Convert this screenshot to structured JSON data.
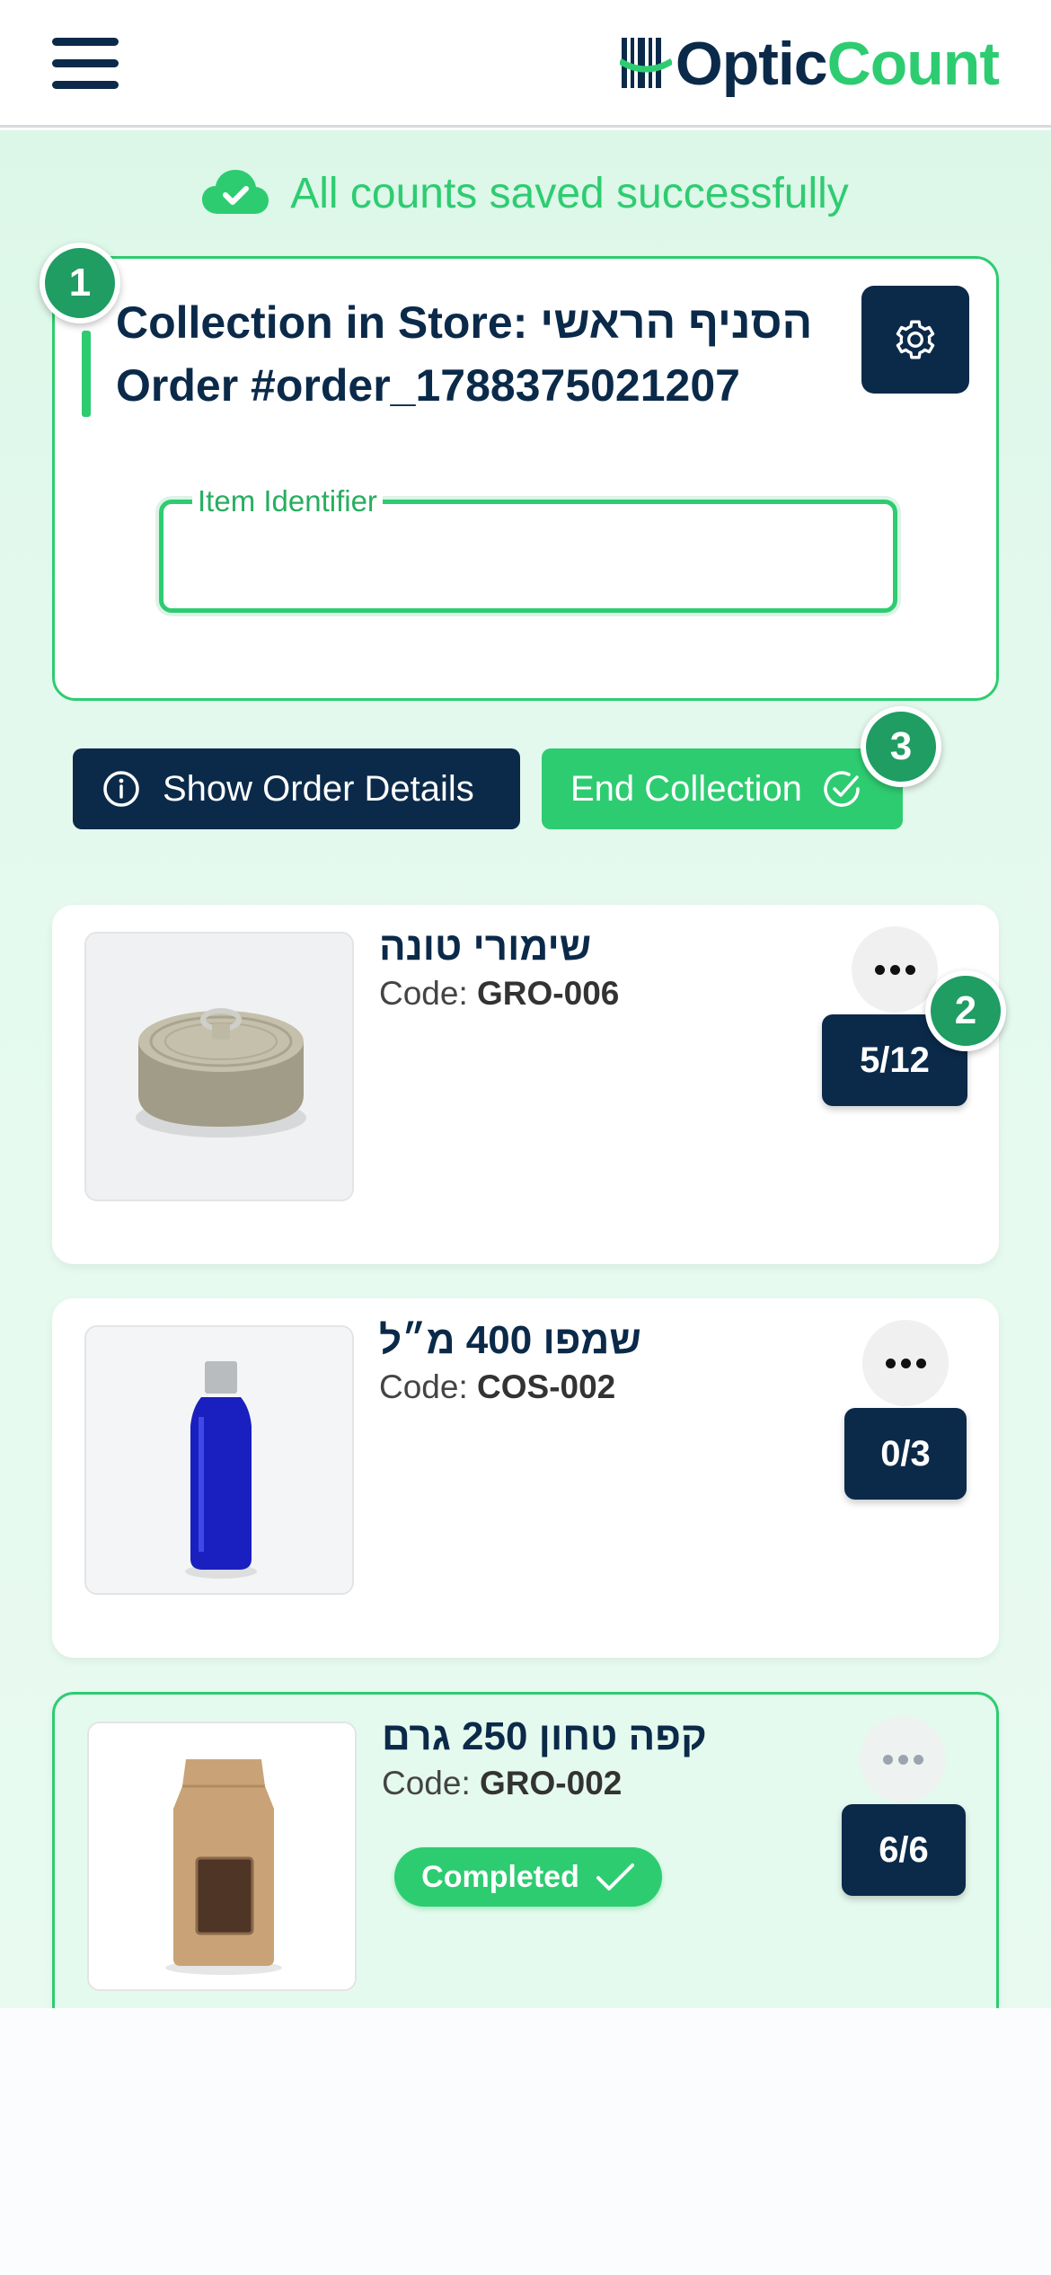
{
  "header": {
    "logo_part1": "Optic",
    "logo_part2": "Count",
    "brand_color": "#0b2a4a",
    "accent_color": "#2ecc71"
  },
  "status": {
    "text": "All counts saved successfully",
    "icon": "cloud-check-icon"
  },
  "collection": {
    "title_line1": "Collection in Store: הסניף הראשי",
    "title_line2": "Order #order_1788375021207",
    "settings_icon": "gear-icon",
    "field_label": "Item Identifier",
    "field_value": ""
  },
  "badges": {
    "b1": "1",
    "b2": "2",
    "b3": "3"
  },
  "actions": {
    "details_label": "Show Order Details",
    "end_label": "End Collection"
  },
  "items": [
    {
      "name": "שימורי טונה",
      "code_label": "Code: ",
      "code": "GRO-006",
      "count": "5/12",
      "completed": false
    },
    {
      "name": "שמפו 400 מ״ל",
      "code_label": "Code: ",
      "code": "COS-002",
      "count": "0/3",
      "completed": false
    },
    {
      "name": "קפה טחון 250 גרם",
      "code_label": "Code: ",
      "code": "GRO-002",
      "count": "6/6",
      "completed": true,
      "status_label": "Completed"
    }
  ]
}
